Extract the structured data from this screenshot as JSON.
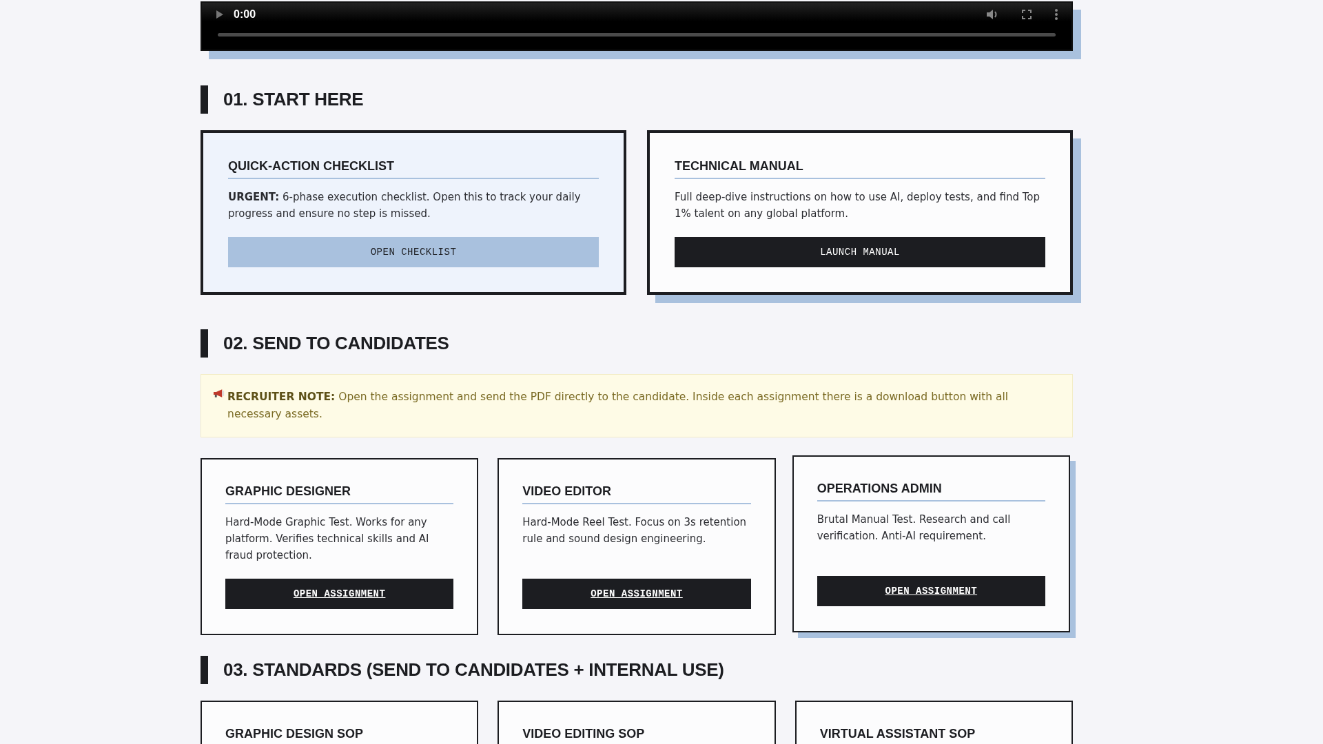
{
  "video": {
    "time": "0:00"
  },
  "sections": [
    {
      "heading": "01. START HERE",
      "cards": [
        {
          "kind": "featured",
          "hovered": false,
          "title": "QUICK-ACTION CHECKLIST",
          "text": "**URGENT:** 6-phase execution checklist. Open this to track your daily progress and ensure no step is missed.",
          "button": "OPEN CHECKLIST"
        },
        {
          "kind": "manual",
          "hovered": false,
          "title": "TECHNICAL MANUAL",
          "text": "Full deep-dive instructions on how to use AI, deploy tests, and find Top 1% talent on any global platform.",
          "button": "LAUNCH MANUAL"
        }
      ]
    },
    {
      "heading": "02. SEND TO CANDIDATES",
      "note": {
        "label": "RECRUITER NOTE:",
        "text": "Open the assignment and send the PDF directly to the candidate. Inside each assignment there is a download button with all necessary assets."
      },
      "cards": [
        {
          "kind": "assignment",
          "hovered": false,
          "title": "GRAPHIC DESIGNER",
          "text": "Hard-Mode Graphic Test. Works for any platform. Verifies technical skills and AI fraud protection.",
          "button": "OPEN ASSIGNMENT"
        },
        {
          "kind": "assignment",
          "hovered": false,
          "title": "VIDEO EDITOR",
          "text": "Hard-Mode Reel Test. Focus on 3s retention rule and sound design engineering.",
          "button": "OPEN ASSIGNMENT"
        },
        {
          "kind": "assignment",
          "hovered": true,
          "title": "OPERATIONS ADMIN",
          "text": "Brutal Manual Test. Research and call verification. Anti-AI requirement.",
          "button": "OPEN ASSIGNMENT"
        }
      ]
    },
    {
      "heading": "03. STANDARDS (SEND TO CANDIDATES + INTERNAL USE)",
      "cards": [
        {
          "kind": "stub",
          "hovered": false,
          "title": "GRAPHIC DESIGN SOP"
        },
        {
          "kind": "stub",
          "hovered": false,
          "title": "VIDEO EDITING SOP"
        },
        {
          "kind": "stub",
          "hovered": false,
          "title": "VIRTUAL ASSISTANT SOP"
        }
      ]
    }
  ]
}
